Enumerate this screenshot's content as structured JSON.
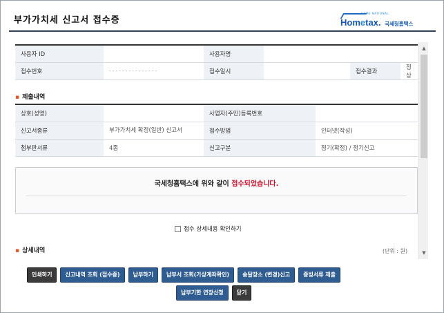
{
  "window": {
    "title": "부가가치세 신고서 접수증",
    "logo": {
      "brand_prefix": "Hom",
      "brand_e": "e",
      "brand_suffix": "tax.",
      "brand_kr": "국세청홈택스",
      "tiny": "HOME NATIONAL"
    }
  },
  "summary_table": [
    {
      "label1": "사용자 ID",
      "value1": "",
      "label2": "사용자명",
      "value2": ""
    },
    {
      "label1": "접수번호",
      "value1": "- - - - - - - - - - - - - - -",
      "label2": "접수일시",
      "value2": "",
      "label3": "접수결과",
      "value3": "정상"
    }
  ],
  "submission_section": {
    "heading": "제출내역",
    "rows": [
      {
        "label1": "상호(성명)",
        "value1": "",
        "label2": "사업자(주민)등록번호",
        "value2": ""
      },
      {
        "label1": "신고서종류",
        "value1": "부가가치세 확정(일반) 신고서",
        "label2": "접수방법",
        "value2": "인터넷(작성)"
      },
      {
        "label1": "첨부판서류",
        "value1": "4종",
        "label2": "신고구분",
        "value2": "정기(확정) / 정기신고"
      }
    ]
  },
  "message": {
    "before": "국세청홈택스에 위와 같이 ",
    "highlight": "접수되었습니다."
  },
  "detail_check": {
    "label": "접수 상세내용 확인하기"
  },
  "detail_section": {
    "heading": "상세내역",
    "unit": "(단위 : 원)"
  },
  "buttons_row1": [
    "인쇄하기",
    "신고내역 조회 (접수증)",
    "납부하기",
    "납부서 조회(가상계좌확인)",
    "송달장소 (변경)신고",
    "증빙서류 제출"
  ],
  "buttons_row2": [
    "납부기한 연장신청",
    "닫기"
  ],
  "colors": {
    "accent": "#2f5d91",
    "highlight": "#c8102e",
    "bullet": "#e15e2a"
  }
}
